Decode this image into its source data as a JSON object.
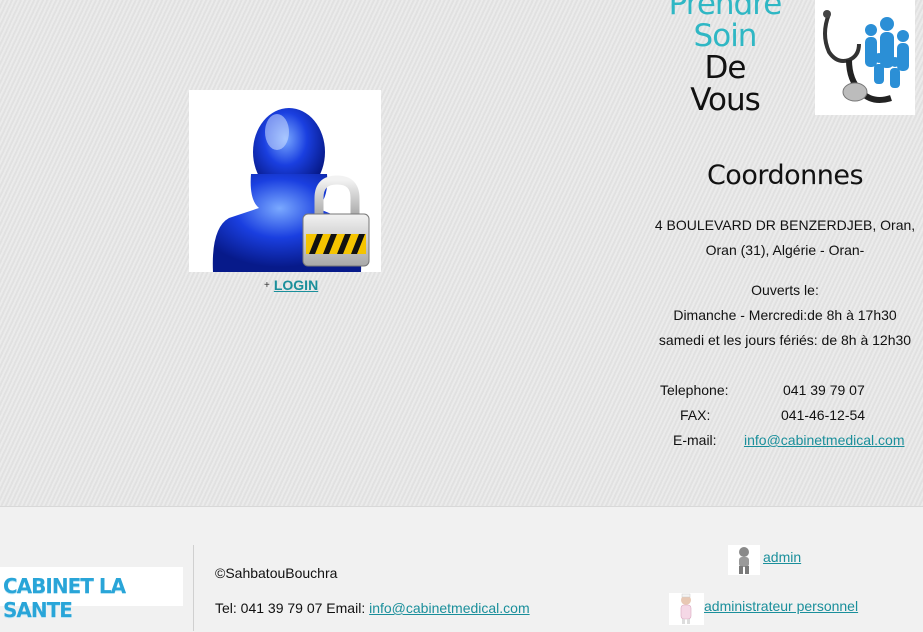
{
  "slogan": {
    "line1": "Prendre",
    "line2": "Soin",
    "line3": "De",
    "line4": "Vous"
  },
  "login": {
    "plus": "+",
    "label": "LOGIN"
  },
  "coordonnees": {
    "title": "Coordonnes",
    "address_line1": "4 BOULEVARD DR BENZERDJEB, Oran,",
    "address_line2": "Oran (31), Algérie - Oran-",
    "hours_title": "Ouverts le:",
    "hours_line1": "Dimanche - Mercredi:de 8h à 17h30",
    "hours_line2": "samedi et les jours fériés: de 8h à 12h30",
    "telephone_label": "Telephone:",
    "telephone_value": "041 39 79 07",
    "fax_label": "FAX:",
    "fax_value": "041-46-12-54",
    "email_label": "E-mail:",
    "email_value": "info@cabinetmedical.com"
  },
  "footer": {
    "brand": "CABINET LA SANTE",
    "copyright": "©SahbatouBouchra",
    "tel_prefix": "Tel: 041 39 79 07 Email: ",
    "email": "info@cabinetmedical.com",
    "admin_link": "admin",
    "staff_admin_link": "administrateur personnel"
  },
  "colors": {
    "accent": "#1a8f9b",
    "slogan_teal": "#2fb7c4",
    "brand_blue": "#29a5d8"
  },
  "icons": [
    "user-lock-icon",
    "stethoscope-family-icon",
    "admin-user-icon",
    "nurse-icon"
  ]
}
